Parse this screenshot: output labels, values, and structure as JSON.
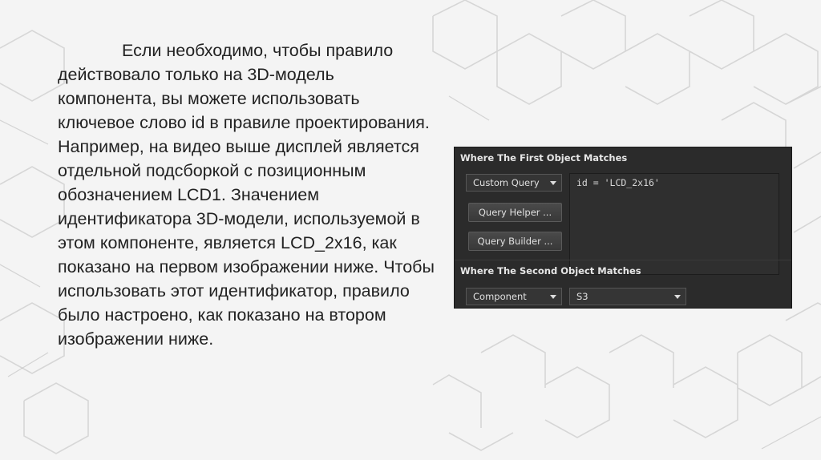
{
  "description_text": "Если необходимо, чтобы правило действовало только на 3D-модель компонента, вы можете использовать ключевое слово id в правиле проектирования. Например, на видео выше дисплей является отдельной подсборкой с позиционным обозначением LCD1. Значением идентификатора 3D-модели, используемой в этом компоненте, является LCD_2x16, как показано на первом изображении ниже. Чтобы использовать этот идентификатор, правило было настроено, как показано на втором изображении ниже.",
  "query_panel": {
    "first_header": "Where The First Object Matches",
    "first_dropdown": "Custom Query",
    "query_helper_label": "Query Helper ...",
    "query_builder_label": "Query Builder ...",
    "query_text": "id = 'LCD_2x16'",
    "second_header": "Where The Second Object Matches",
    "second_dropdown": "Component",
    "second_value_dropdown": "S3"
  },
  "colors": {
    "panel_bg": "#2b2b2b",
    "page_bg": "#f4f4f4",
    "text": "#222222"
  }
}
